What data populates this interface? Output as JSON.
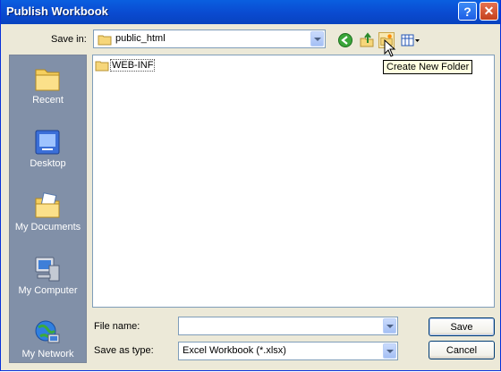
{
  "window": {
    "title": "Publish Workbook"
  },
  "toolbar": {
    "save_in_label": "Save in:",
    "save_in_value": "public_html"
  },
  "tooltip": "Create New Folder",
  "places": [
    {
      "label": "Recent",
      "icon": "recent-folder-icon"
    },
    {
      "label": "Desktop",
      "icon": "desktop-icon"
    },
    {
      "label": "My Documents",
      "icon": "my-documents-icon"
    },
    {
      "label": "My Computer",
      "icon": "my-computer-icon"
    },
    {
      "label": "My Network",
      "icon": "my-network-icon"
    }
  ],
  "files": [
    {
      "name": "WEB-INF",
      "icon": "folder-icon"
    }
  ],
  "form": {
    "file_name_label": "File name:",
    "file_name_value": "",
    "save_as_type_label": "Save as type:",
    "save_as_type_value": "Excel Workbook (*.xlsx)"
  },
  "buttons": {
    "save": "Save",
    "cancel": "Cancel"
  },
  "colors": {
    "titlebar": "#0a4ad0",
    "dialog_bg": "#ece9d8",
    "places_bar": "#8190a8"
  }
}
